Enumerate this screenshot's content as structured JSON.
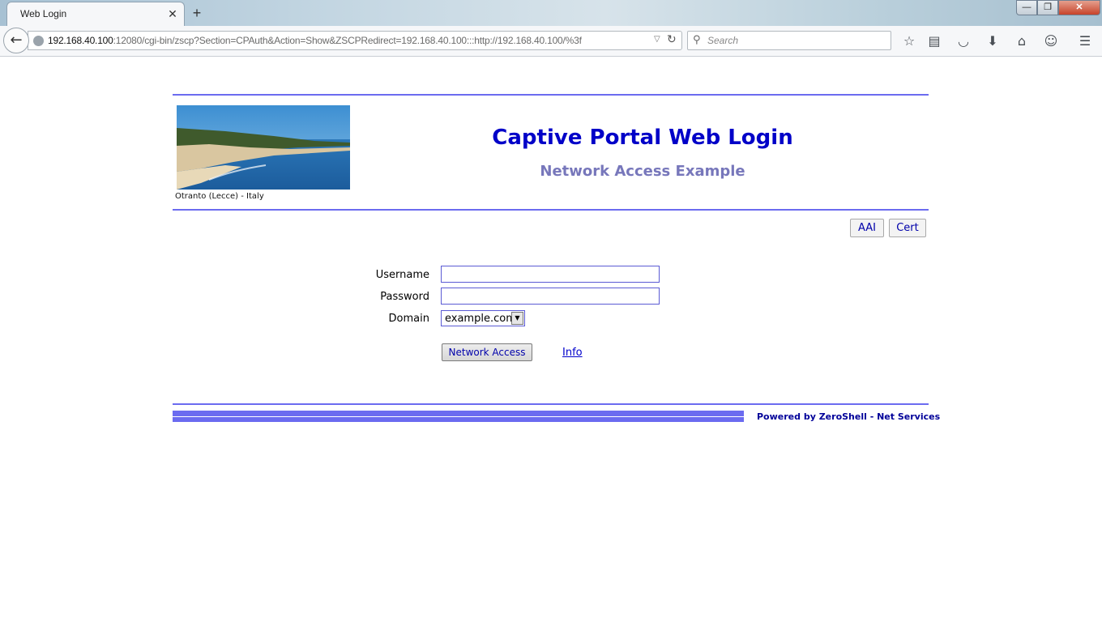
{
  "browser": {
    "tab_title": "Web Login",
    "tab_close": "✕",
    "new_tab": "+",
    "window_buttons": {
      "minimize": "—",
      "maximize": "❐",
      "close": "✕"
    },
    "url_host": "192.168.40.100",
    "url_rest": ":12080/cgi-bin/zscp?Section=CPAuth&Action=Show&ZSCPRedirect=192.168.40.100:::http://192.168.40.100/%3f",
    "search_placeholder": "Search",
    "toolbar_icons": [
      "bookmark-star-icon",
      "reading-list-icon",
      "pocket-icon",
      "download-icon",
      "home-icon",
      "chat-icon",
      "menu-icon"
    ]
  },
  "header": {
    "photo_caption": "Otranto (Lecce) - Italy",
    "title": "Captive Portal Web Login",
    "subtitle": "Network Access Example"
  },
  "auth_buttons": {
    "aai": "AAI",
    "cert": "Cert"
  },
  "form": {
    "username_label": "Username",
    "username_value": "",
    "password_label": "Password",
    "password_value": "",
    "domain_label": "Domain",
    "domain_value": "example.com",
    "submit_label": "Network Access",
    "info_label": "Info"
  },
  "footer": {
    "powered_by": "Powered by ZeroShell - Net Services"
  },
  "colors": {
    "accent_rule": "#6b6bf0",
    "title": "#0000c8",
    "subtitle": "#7777bb",
    "link": "#0000cc"
  }
}
